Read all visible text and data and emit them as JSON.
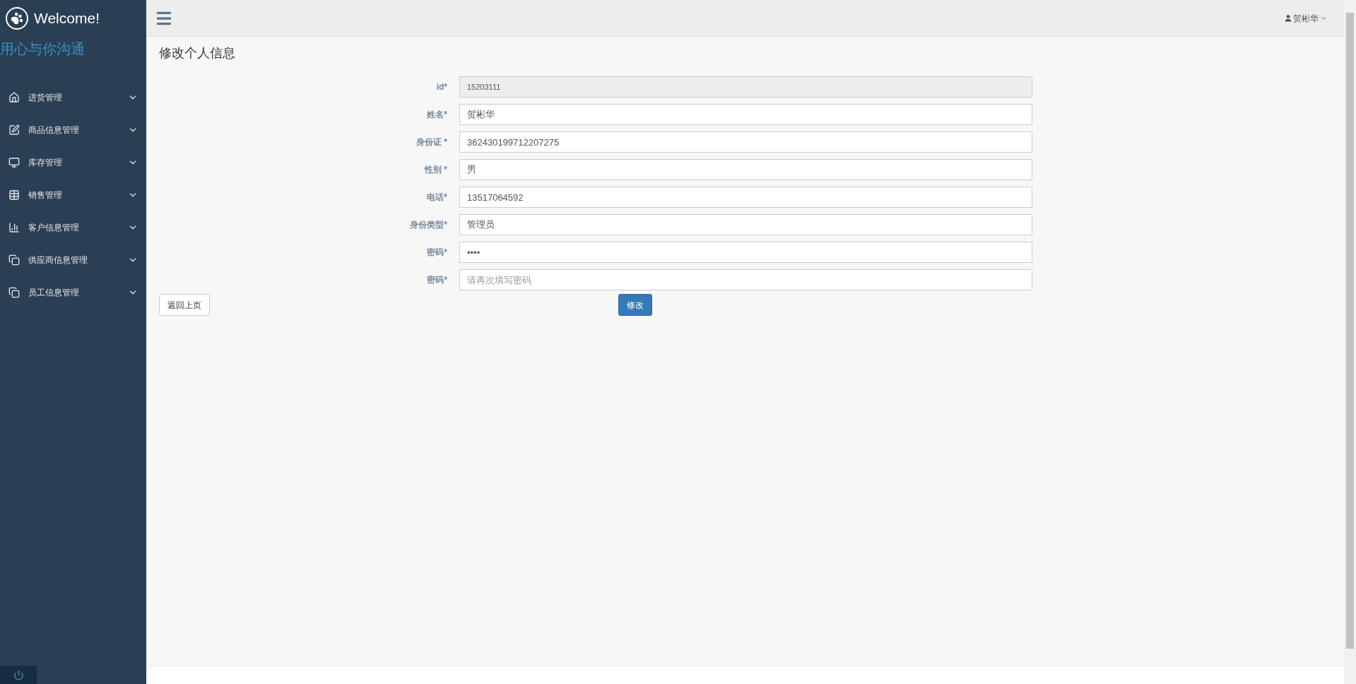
{
  "sidebar": {
    "brand": "Welcome!",
    "slogan": "用心与你沟通",
    "items": [
      {
        "label": "进货管理",
        "kind": "home"
      },
      {
        "label": "商品信息管理",
        "kind": "edit"
      },
      {
        "label": "库存管理",
        "kind": "monitor"
      },
      {
        "label": "销售管理",
        "kind": "table"
      },
      {
        "label": "客户信息管理",
        "kind": "chart"
      },
      {
        "label": "供应商信息管理",
        "kind": "copy"
      },
      {
        "label": "员工信息管理",
        "kind": "copy"
      }
    ]
  },
  "top_bar": {
    "user": "贺彬华"
  },
  "page_title": "修改个人信息",
  "form": {
    "fields": [
      {
        "label": "id*",
        "value": "15203111",
        "disabled": true
      },
      {
        "label": "姓名*",
        "value": "贺彬华",
        "disabled": false
      },
      {
        "label": "身份证 *",
        "value": "362430199712207275",
        "disabled": false
      },
      {
        "label": "性别 *",
        "value": "男",
        "disabled": false
      },
      {
        "label": "电话*",
        "value": "13517064592",
        "disabled": false
      },
      {
        "label": "身份类型*",
        "value": "管理员",
        "disabled": false
      },
      {
        "label": "密码*",
        "value": "••••",
        "disabled": false
      },
      {
        "label": "密码*",
        "placeholder": "请再次填写密码",
        "disabled": false
      }
    ],
    "back_button": "返回上页",
    "submit_button": "修改"
  }
}
